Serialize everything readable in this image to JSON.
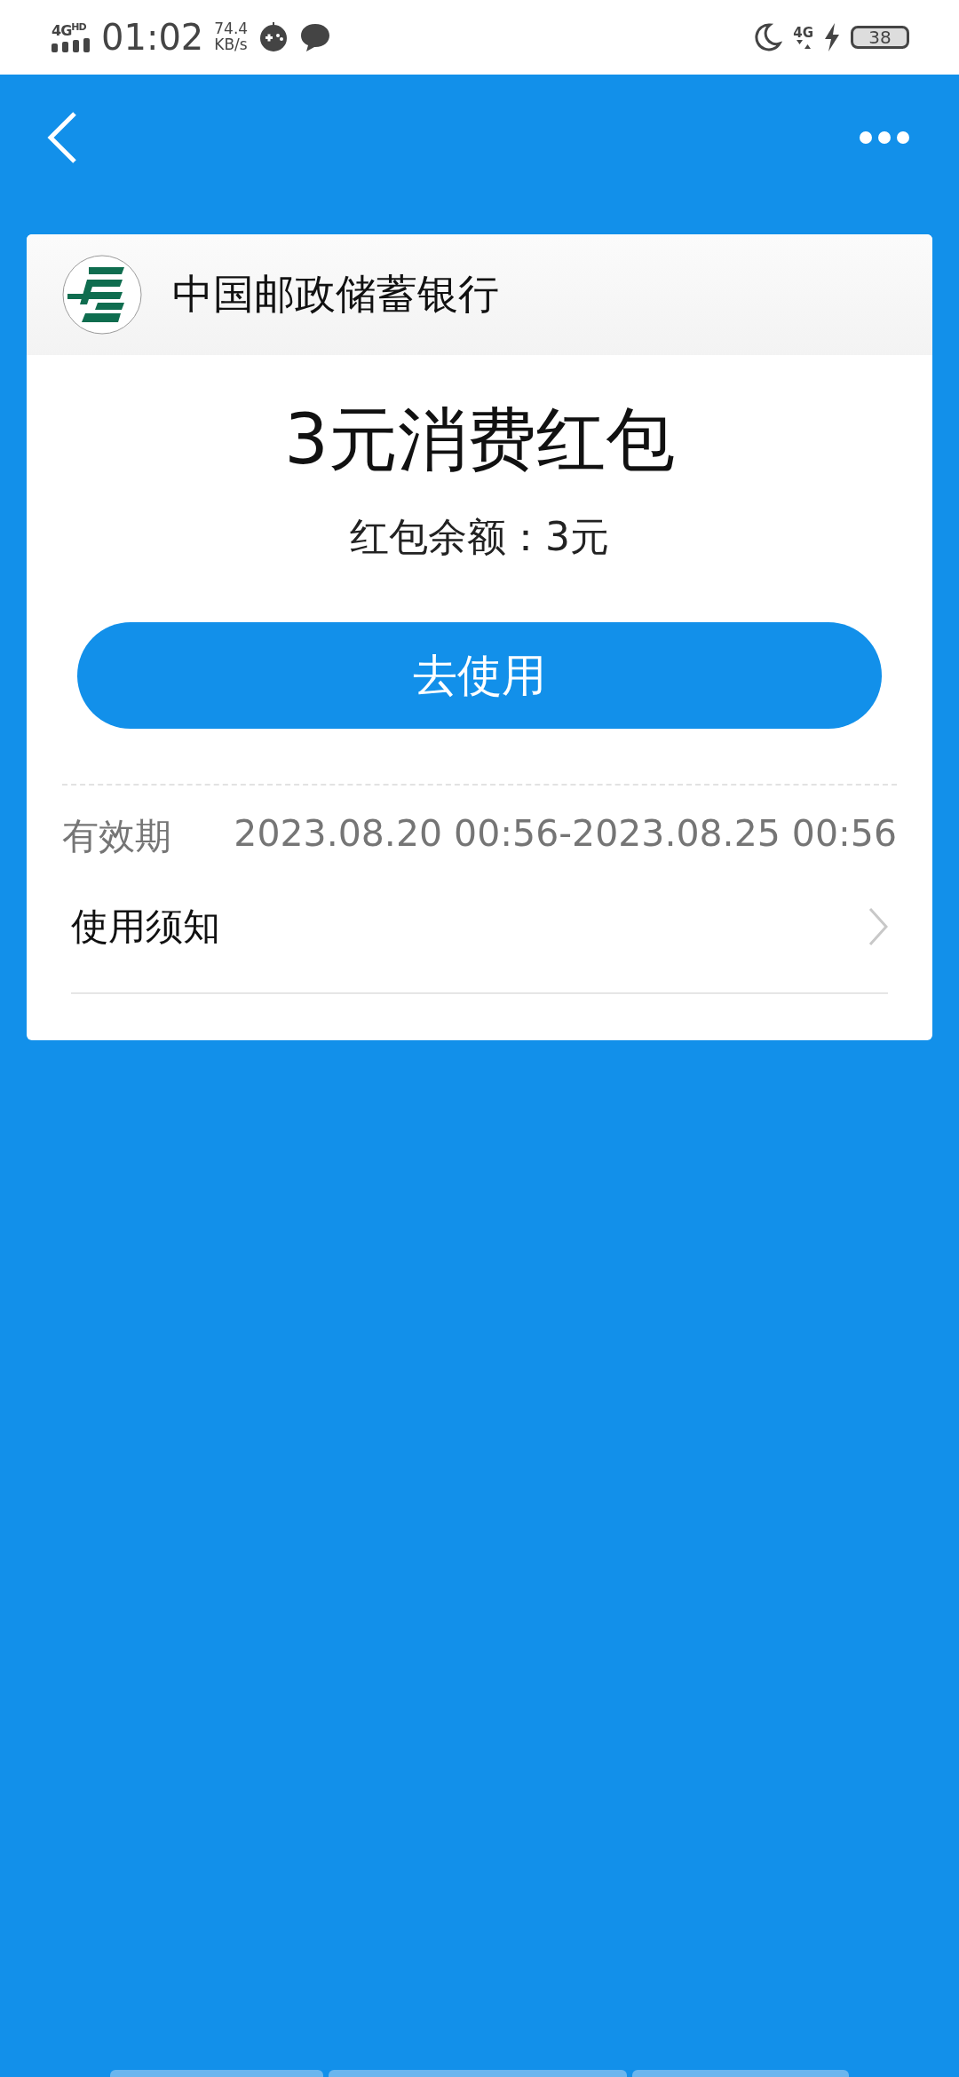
{
  "status_bar": {
    "network": "4G",
    "network_badge": "HD",
    "time": "01:02",
    "speed": "74.4",
    "speed_unit": "KB/s",
    "mobile": "4G",
    "battery": "38"
  },
  "card": {
    "bank_name": "中国邮政储蓄银行",
    "title": "3元消费红包",
    "balance": "红包余额：3元",
    "action": "去使用",
    "validity_label": "有效期",
    "validity_value": "2023.08.20 00:56-2023.08.25 00:56",
    "notice": "使用须知"
  }
}
